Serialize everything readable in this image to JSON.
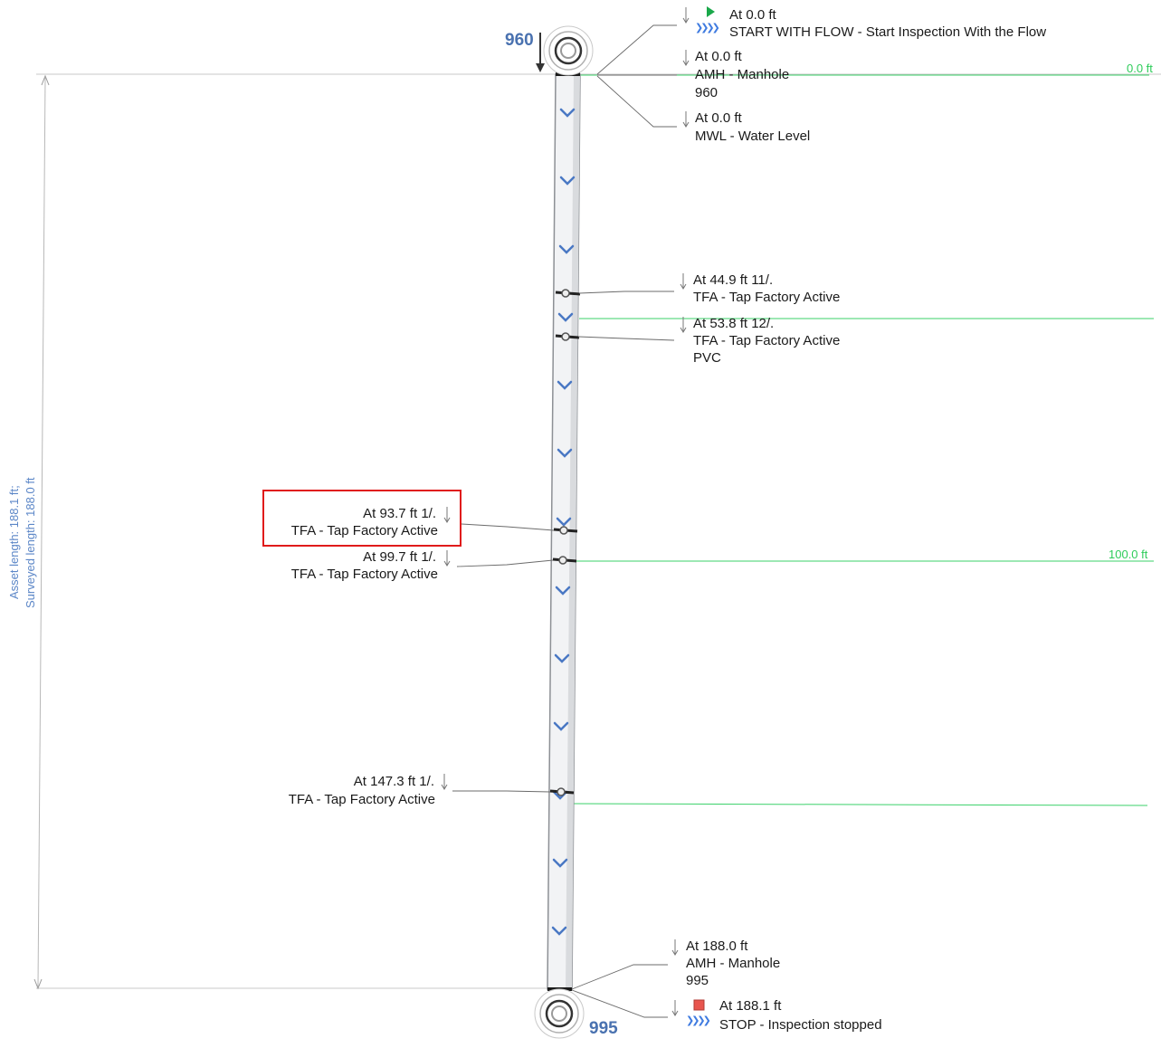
{
  "upstream_node": "960",
  "downstream_node": "995",
  "dimension": {
    "asset_length": "Asset length: 188.1 ft;",
    "surveyed_length": "Surveyed length: 188.0 ft"
  },
  "markers": [
    {
      "label": "0.0 ft",
      "distance_ft": 0.0
    },
    {
      "label": "100.0 ft",
      "distance_ft": 100.0
    }
  ],
  "observations": {
    "start": {
      "line1": "At 0.0 ft",
      "line2": "START WITH FLOW - Start Inspection With the Flow"
    },
    "amh_start": {
      "line1": "At 0.0 ft",
      "line2": "AMH - Manhole",
      "line3": "960"
    },
    "mwl": {
      "line1": "At 0.0 ft",
      "line2": "MWL - Water Level"
    },
    "tfa_44": {
      "line1": "At 44.9 ft 11/.",
      "line2": "TFA - Tap Factory Active"
    },
    "tfa_53": {
      "line1": "At 53.8 ft 12/.",
      "line2": "TFA - Tap Factory Active",
      "line3": "PVC"
    },
    "tfa_93": {
      "line1": "At 93.7 ft 1/.",
      "line2": "TFA - Tap Factory Active"
    },
    "tfa_99": {
      "line1": "At 99.7 ft 1/.",
      "line2": "TFA - Tap Factory Active"
    },
    "tfa_147": {
      "line1": "At 147.3 ft 1/.",
      "line2": "TFA - Tap Factory Active"
    },
    "amh_end": {
      "line1": "At 188.0 ft",
      "line2": "AMH - Manhole",
      "line3": "995"
    },
    "stop": {
      "line1": "At 188.1 ft",
      "line2": "STOP - Inspection stopped"
    }
  },
  "colors": {
    "pipe_fill": "#f2f3f5",
    "pipe_edge": "#8d9095",
    "flow_chevron": "#4a78c4",
    "marker_line": "#2ecc5a",
    "leader_line": "#6b6b6b",
    "highlight": "#e01b1b",
    "start_icon": "#1aa84a",
    "stop_icon": "#e8554e"
  }
}
